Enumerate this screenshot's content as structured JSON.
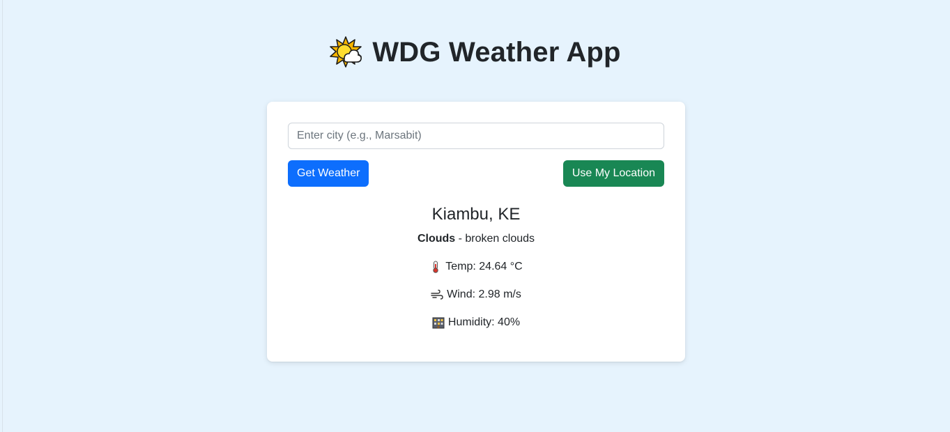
{
  "header": {
    "title": "WDG Weather App",
    "icon": "sun-behind-cloud-icon"
  },
  "search": {
    "placeholder": "Enter city (e.g., Marsabit)",
    "value": ""
  },
  "buttons": {
    "get_weather_label": "Get Weather",
    "use_location_label": "Use My Location"
  },
  "weather": {
    "location": "Kiambu, KE",
    "condition_main": "Clouds",
    "condition_separator": " - ",
    "condition_description": "broken clouds",
    "temp_text": "Temp: 24.64 °C",
    "wind_text": "Wind: 2.98 m/s",
    "humidity_text": "Humidity: 40%",
    "icons": {
      "temp": "thermometer-icon",
      "wind": "wind-icon",
      "humidity": "humidity-icon"
    }
  },
  "colors": {
    "background": "#e6f3fd",
    "primary": "#0d6efd",
    "success": "#198754",
    "text": "#212529"
  }
}
